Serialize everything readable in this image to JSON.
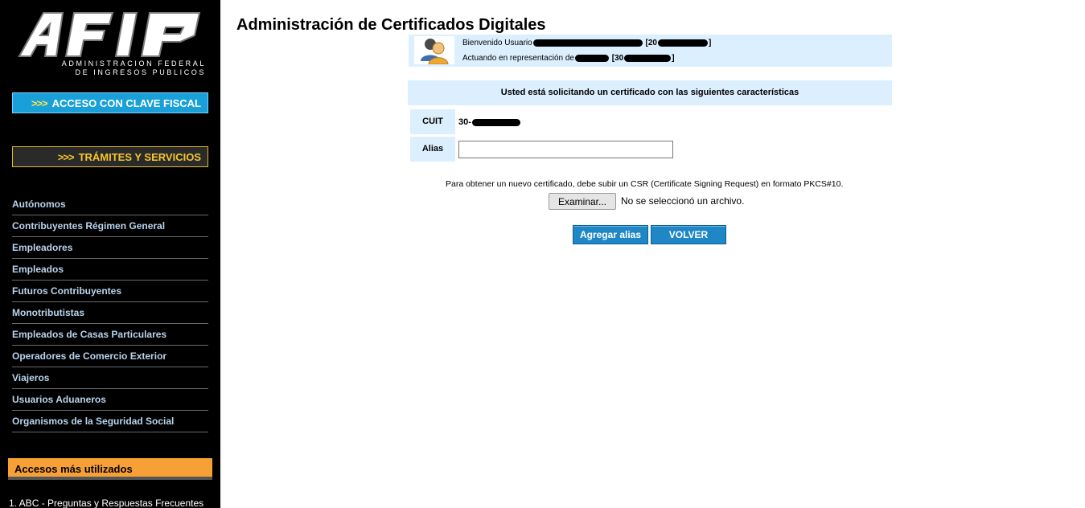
{
  "sidebar": {
    "logo": {
      "letters": "AFIP",
      "line1": "ADMINISTRACION FEDERAL",
      "line2": "DE INGRESOS PUBLICOS"
    },
    "clave_fiscal": {
      "arrows": ">>>",
      "label": "ACCESO CON CLAVE FISCAL"
    },
    "tramites": {
      "arrows": ">>>",
      "label": "TRÁMITES Y SERVICIOS"
    },
    "nav_items": [
      "Autónomos",
      "Contribuyentes Régimen General",
      "Empleadores",
      "Empleados",
      "Futuros Contribuyentes",
      "Monotributistas",
      "Empleados de Casas Particulares",
      "Operadores de Comercio Exterior",
      "Viajeros",
      "Usuarios Aduaneros",
      "Organismos de la Seguridad Social"
    ],
    "accesos_title": "Accesos más utilizados",
    "accesos_first": "1. ABC - Preguntas y Respuestas Frecuentes"
  },
  "main": {
    "title": "Administración de Certificados Digitales",
    "user": {
      "welcome": "Bienvenido Usuario",
      "welcome_bracket_open": "[20",
      "welcome_bracket_close": "]",
      "acting": "Actuando en representación de",
      "acting_bracket_open": "[30",
      "acting_bracket_close": "]"
    },
    "request_header": "Usted está solicitando un certificado con las siguientes características",
    "cuit_label": "CUIT",
    "cuit_value_prefix": "30-",
    "alias_label": "Alias",
    "alias_value": "",
    "csr_text": "Para obtener un nuevo certificado, debe subir un CSR (Certificate Signing Request) en formato PKCS#10.",
    "file_button": "Examinar...",
    "file_status": "No se seleccionó un archivo.",
    "add_alias_button": "Agregar alias",
    "back_button": "VOLVER"
  },
  "colors": {
    "sidebar_bg": "#000000",
    "clave_btn": "#1aa0d8",
    "tramites_border": "#e8b824",
    "nav_text": "#b8d4ec",
    "accesos_bg": "#f7a035",
    "info_bg": "#dcefff",
    "action_btn": "#1f87c6"
  }
}
